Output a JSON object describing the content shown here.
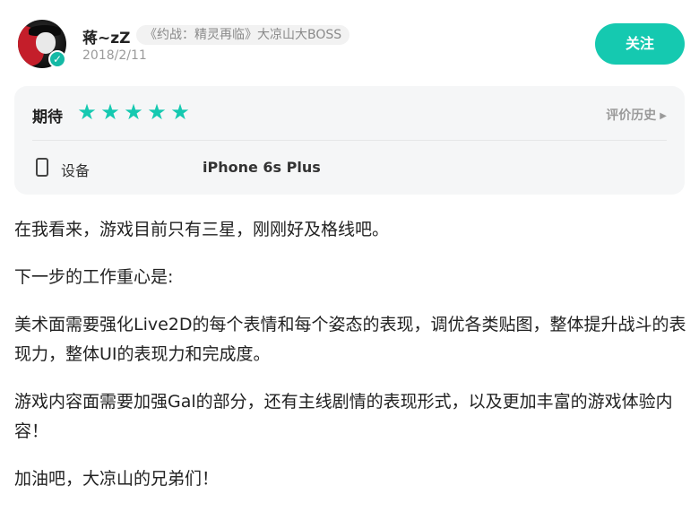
{
  "header": {
    "username": "蒋~zZ",
    "title_tag": "《约战：精灵再临》大凉山大BOSS",
    "date": "2018/2/11",
    "follow_label": "关注",
    "verify_mark": "✓"
  },
  "rating": {
    "label": "期待",
    "stars": 5,
    "max_stars": 5,
    "star_glyph": "★",
    "star_color": "#15c9b0",
    "history_label": "评价历史",
    "history_arrow": "▶"
  },
  "device": {
    "icon": "phone-icon",
    "label": "设备",
    "value": "iPhone 6s Plus"
  },
  "review": {
    "paragraphs": [
      "在我看来，游戏目前只有三星，刚刚好及格线吧。",
      "下一步的工作重心是:",
      "美术面需要强化Live2D的每个表情和每个姿态的表现，调优各类贴图，整体提升战斗的表现力，整体UI的表现力和完成度。",
      "游戏内容面需要加强Gal的部分，还有主线剧情的表现形式，以及更加丰富的游戏体验内容！",
      "加油吧，大凉山的兄弟们！"
    ]
  },
  "colors": {
    "accent": "#15c9b0",
    "card_bg": "#f5f6f7",
    "muted": "#9a9a9a"
  }
}
